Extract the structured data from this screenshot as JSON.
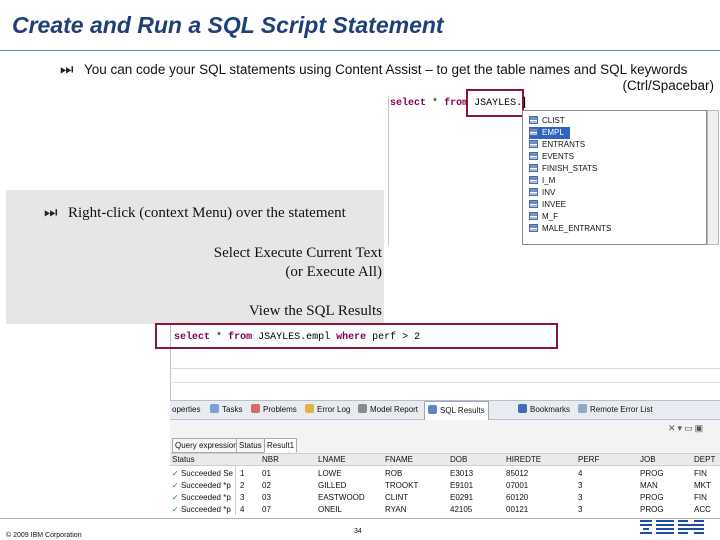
{
  "slide": {
    "title": "Create and Run a SQL Script Statement",
    "bullet1": {
      "line1": "You can code your SQL statements using Content Assist – to get the table names and SQL keywords",
      "line2": "(Ctrl/Spacebar)"
    },
    "bullet2": "Right-click (context Menu) over the statement",
    "step1_line1": "Select Execute Current Text",
    "step1_line2": "(or Execute All)",
    "step2": "View the SQL Results",
    "copyright": "© 2009 IBM Corporation",
    "page_number": "34",
    "icons": {
      "bullet": "fast-forward-icon",
      "logo": "ibm-logo"
    }
  },
  "editor_top": {
    "kw_select": "select",
    "star": "*",
    "kw_from": "from",
    "schema": "JSAYLES."
  },
  "content_assist": {
    "items": [
      "CLIST",
      "EMPL",
      "ENTRANTS",
      "EVENTS",
      "FINISH_STATS",
      "I_M",
      "INV",
      "INVEE",
      "M_F",
      "MALE_ENTRANTS"
    ],
    "selected_index": 1
  },
  "editor_bottom": {
    "kw_select": "select",
    "star": "*",
    "kw_from": "from",
    "table": "JSAYLES.empl",
    "kw_where": "where",
    "condition": "perf > 2"
  },
  "view_tabs": [
    "operties",
    "Tasks",
    "Problems",
    "Error Log",
    "Model Report",
    "SQL Results",
    "Bookmarks",
    "Remote Error List"
  ],
  "active_view_tab": "SQL Results",
  "results_tabs": [
    "Query expression",
    "Status",
    "Result1"
  ],
  "status_header": "Status",
  "status_rows": [
    "Succeeded",
    "Succeeded",
    "Succeeded",
    "Succeeded"
  ],
  "status_row_nums": [
    "1",
    "2",
    "3",
    "4"
  ],
  "status_row_suffix": [
    "Se",
    "*p",
    "*p",
    "*p"
  ],
  "result_columns": [
    "NBR",
    "LNAME",
    "FNAME",
    "DOB",
    "HIREDTE",
    "PERF",
    "JOB",
    "DEPT"
  ],
  "result_rows": [
    [
      "01",
      "LOWE",
      "ROB",
      "E3013",
      "85012",
      "4",
      "PROG",
      "FIN"
    ],
    [
      "02",
      "GILLED",
      "TROOKT",
      "E9101",
      "07001",
      "3",
      "MAN",
      "MKT"
    ],
    [
      "03",
      "EASTWOOD",
      "CLINT",
      "E0291",
      "60120",
      "3",
      "PROG",
      "FIN"
    ],
    [
      "07",
      "ONEIL",
      "RYAN",
      "42105",
      "00121",
      "3",
      "PROG",
      "ACC"
    ]
  ]
}
